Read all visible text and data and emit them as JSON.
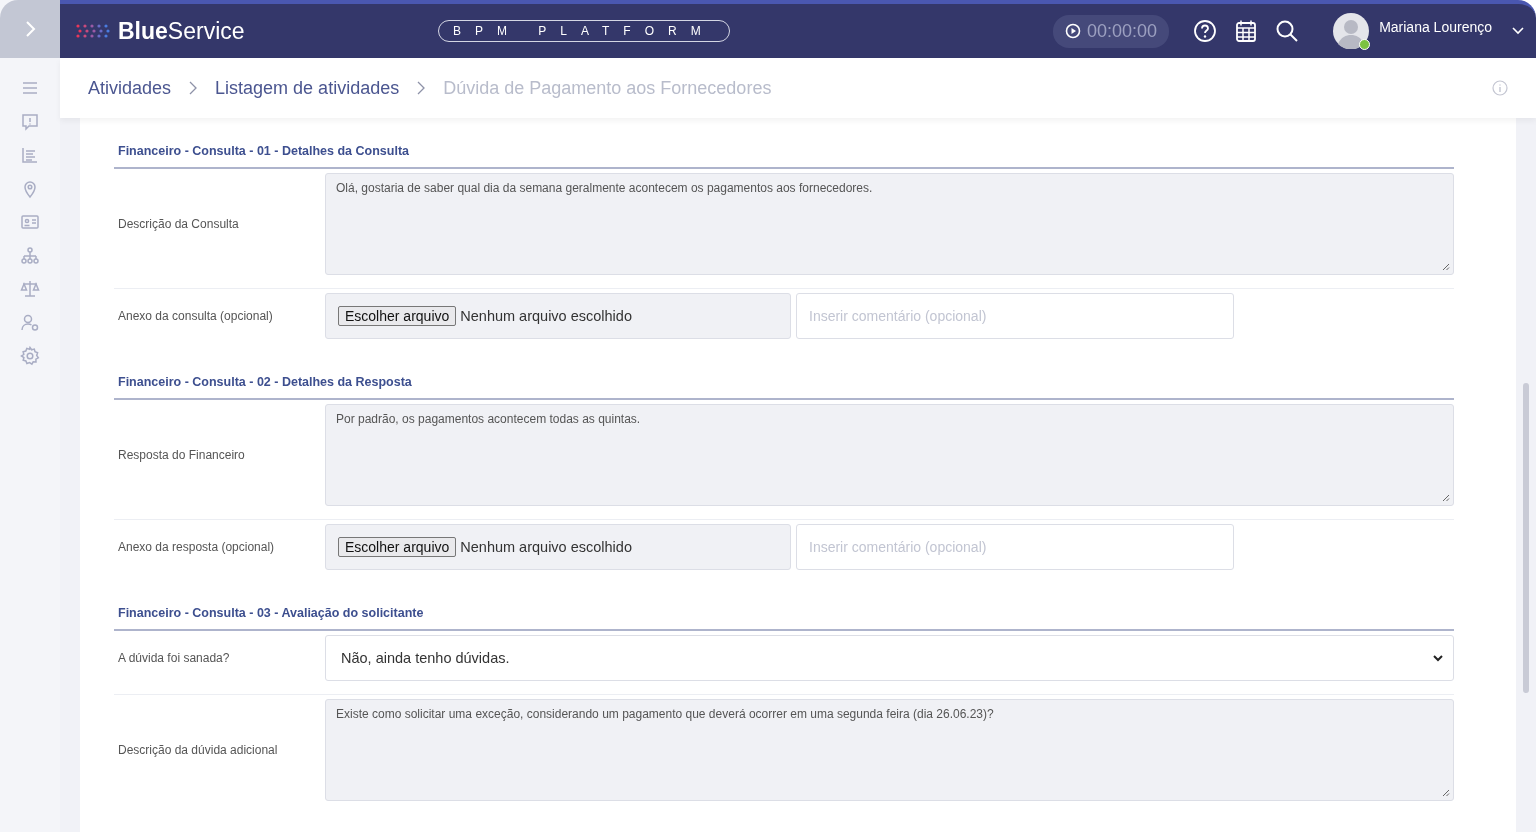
{
  "header": {
    "logo": "**Blue**Service",
    "platform": "BPM PLATFORM",
    "timer": "00:00:00",
    "user": {
      "name": "Mariana Lourenço",
      "online": true
    }
  },
  "breadcrumbs": [
    {
      "label": "Atividades",
      "current": false
    },
    {
      "label": "Listagem de atividades",
      "current": false
    },
    {
      "label": "Dúvida de Pagamento aos Fornecedores",
      "current": true
    }
  ],
  "sections": [
    {
      "title": "Financeiro - Consulta - 01 - Detalhes da Consulta",
      "fields": [
        {
          "kind": "textarea",
          "label": "Descrição da Consulta",
          "value": "Olá, gostaria de saber qual dia da semana geralmente acontecem os pagamentos aos fornecedores."
        },
        {
          "kind": "file",
          "label": "Anexo da consulta (opcional)",
          "button": "Escolher arquivo",
          "status": "Nenhum arquivo escolhido",
          "placeholder": "Inserir comentário (opcional)"
        }
      ]
    },
    {
      "title": "Financeiro - Consulta - 02 - Detalhes da Resposta",
      "fields": [
        {
          "kind": "textarea",
          "label": "Resposta do Financeiro",
          "value": "Por padrão, os pagamentos acontecem todas as quintas."
        },
        {
          "kind": "file",
          "label": "Anexo da resposta (opcional)",
          "button": "Escolher arquivo",
          "status": "Nenhum arquivo escolhido",
          "placeholder": "Inserir comentário (opcional)"
        }
      ]
    },
    {
      "title": "Financeiro - Consulta - 03 - Avaliação do solicitante",
      "fields": [
        {
          "kind": "select",
          "label": "A dúvida foi sanada?",
          "value": "Não, ainda tenho dúvidas."
        },
        {
          "kind": "textarea",
          "label": "Descrição da dúvida adicional",
          "value": "Existe como solicitar uma exceção, considerando um pagamento que deverá ocorrer em uma segunda feira (dia 26.06.23)?"
        }
      ]
    }
  ]
}
